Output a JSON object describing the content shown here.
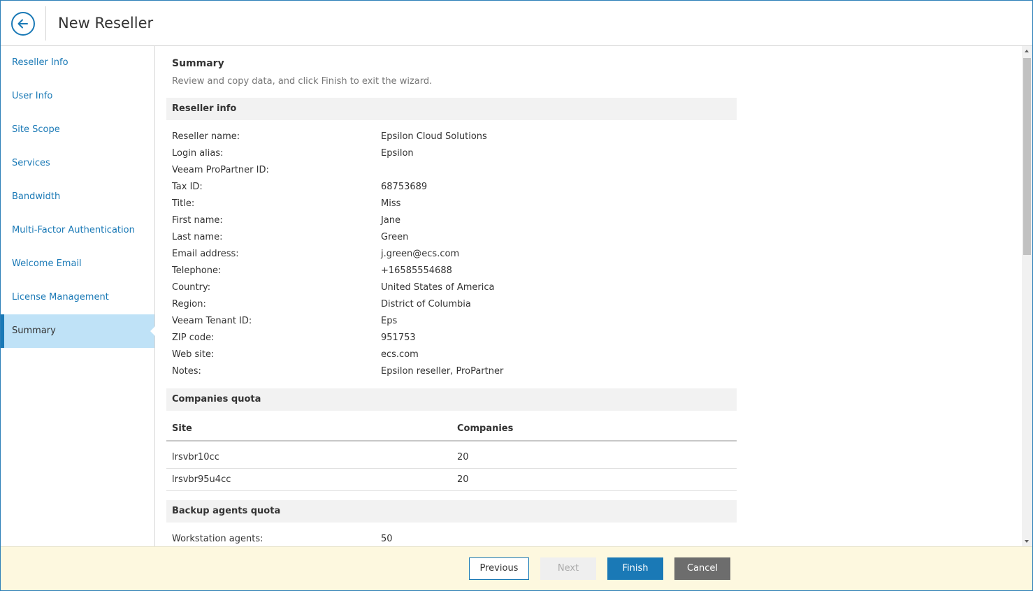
{
  "header": {
    "title": "New Reseller"
  },
  "sidebar": {
    "items": [
      {
        "label": "Reseller Info"
      },
      {
        "label": "User Info"
      },
      {
        "label": "Site Scope"
      },
      {
        "label": "Services"
      },
      {
        "label": "Bandwidth"
      },
      {
        "label": "Multi-Factor Authentication"
      },
      {
        "label": "Welcome Email"
      },
      {
        "label": "License Management"
      },
      {
        "label": "Summary"
      }
    ],
    "active": "Summary"
  },
  "main": {
    "title": "Summary",
    "description": "Review and copy data, and click Finish to exit the wizard.",
    "reseller_info": {
      "heading": "Reseller info",
      "rows": [
        {
          "label": "Reseller name:",
          "value": "Epsilon Cloud Solutions"
        },
        {
          "label": "Login alias:",
          "value": "Epsilon"
        },
        {
          "label": "Veeam ProPartner ID:",
          "value": ""
        },
        {
          "label": "Tax ID:",
          "value": "68753689"
        },
        {
          "label": "Title:",
          "value": "Miss"
        },
        {
          "label": "First name:",
          "value": "Jane"
        },
        {
          "label": "Last name:",
          "value": "Green"
        },
        {
          "label": "Email address:",
          "value": "j.green@ecs.com"
        },
        {
          "label": "Telephone:",
          "value": "+16585554688"
        },
        {
          "label": "Country:",
          "value": "United States of America"
        },
        {
          "label": "Region:",
          "value": "District of Columbia"
        },
        {
          "label": "Veeam Tenant ID:",
          "value": "Eps"
        },
        {
          "label": "ZIP code:",
          "value": "951753"
        },
        {
          "label": "Web site:",
          "value": "ecs.com"
        },
        {
          "label": "Notes:",
          "value": "Epsilon reseller, ProPartner"
        }
      ]
    },
    "companies_quota": {
      "heading": "Companies quota",
      "columns": [
        "Site",
        "Companies"
      ],
      "rows": [
        [
          "lrsvbr10cc",
          "20"
        ],
        [
          "lrsvbr95u4cc",
          "20"
        ]
      ]
    },
    "backup_agents_quota": {
      "heading": "Backup agents quota",
      "rows": [
        {
          "label": "Workstation agents:",
          "value": "50"
        }
      ]
    }
  },
  "footer": {
    "previous_label": "Previous",
    "next_label": "Next",
    "finish_label": "Finish",
    "cancel_label": "Cancel"
  },
  "colors": {
    "accent": "#1a79b6",
    "active_nav_bg": "#bfe2f7",
    "footer_bg": "#fdf8df",
    "cancel_bg": "#6d6d6d"
  },
  "icons": {
    "back": "arrow-left-circle-icon"
  }
}
